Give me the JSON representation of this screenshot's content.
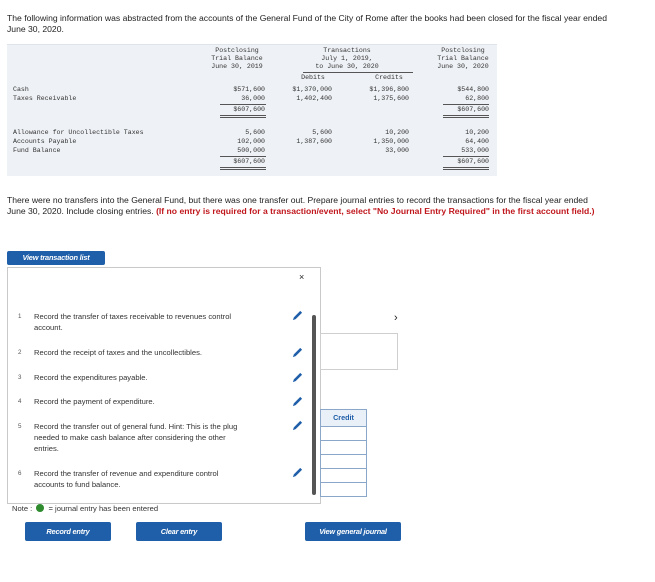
{
  "intro": "The following information was abstracted from the accounts of the General Fund of the City of Rome after the books had been closed for the fiscal year ended June 30, 2020.",
  "table": {
    "headers": {
      "pre": [
        "Postclosing",
        "Trial Balance",
        "June 30, 2019"
      ],
      "trans": [
        "Transactions",
        "July 1, 2019,",
        "to June 30, 2020"
      ],
      "debits": "Debits",
      "credits": "Credits",
      "post": [
        "Postclosing",
        "Trial Balance",
        "June 30, 2020"
      ]
    },
    "debit_rows": [
      {
        "label": "Cash",
        "pre": "$571,600",
        "debits": "$1,370,000",
        "credits": "$1,396,800",
        "post": "$544,800"
      },
      {
        "label": "Taxes Receivable",
        "pre": "36,000",
        "debits": "1,402,400",
        "credits": "1,375,600",
        "post": "62,800"
      }
    ],
    "debit_total": {
      "pre": "$607,600",
      "post": "$607,600"
    },
    "credit_rows": [
      {
        "label": "Allowance for Uncollectible Taxes",
        "pre": "5,600",
        "debits": "5,600",
        "credits": "10,200",
        "post": "10,200"
      },
      {
        "label": "Accounts Payable",
        "pre": "102,000",
        "debits": "1,387,600",
        "credits": "1,350,000",
        "post": "64,400"
      },
      {
        "label": "Fund Balance",
        "pre": "500,000",
        "debits": "",
        "credits": "33,000",
        "post": "533,000"
      }
    ],
    "credit_total": {
      "pre": "$607,600",
      "post": "$607,600"
    }
  },
  "instructions": {
    "text": "There were no transfers into the General Fund, but there was one transfer out. Prepare journal entries to record the transactions for the fiscal year ended June 30, 2020. Include closing entries.",
    "emphasis": "(If no entry is required for a transaction/event, select \"No Journal Entry Required\" in the first account field.)"
  },
  "view_transaction_list": "View transaction list",
  "close_symbol": "×",
  "transactions": [
    {
      "num": "1",
      "text": "Record the transfer of taxes receivable to revenues control account."
    },
    {
      "num": "2",
      "text": "Record the receipt of taxes and the uncollectibles."
    },
    {
      "num": "3",
      "text": "Record the expenditures payable."
    },
    {
      "num": "4",
      "text": "Record the payment of expenditure."
    },
    {
      "num": "5",
      "text": "Record the transfer out of general fund. Hint: This is the plug needed to make cash balance after considering the other entries."
    },
    {
      "num": "6",
      "text": "Record the transfer of revenue and expenditure control accounts to fund balance."
    }
  ],
  "note": {
    "prefix": "Note :",
    "suffix": "= journal entry has been entered"
  },
  "buttons": {
    "record": "Record entry",
    "clear": "Clear entry",
    "view_journal": "View general journal"
  },
  "credit_header": "Credit",
  "chevron": "›",
  "colors": {
    "button": "#1f5ea8",
    "pencil": "#1f5ea8",
    "entered_dot": "#2e8b2e",
    "emphasis": "#c0171d"
  }
}
